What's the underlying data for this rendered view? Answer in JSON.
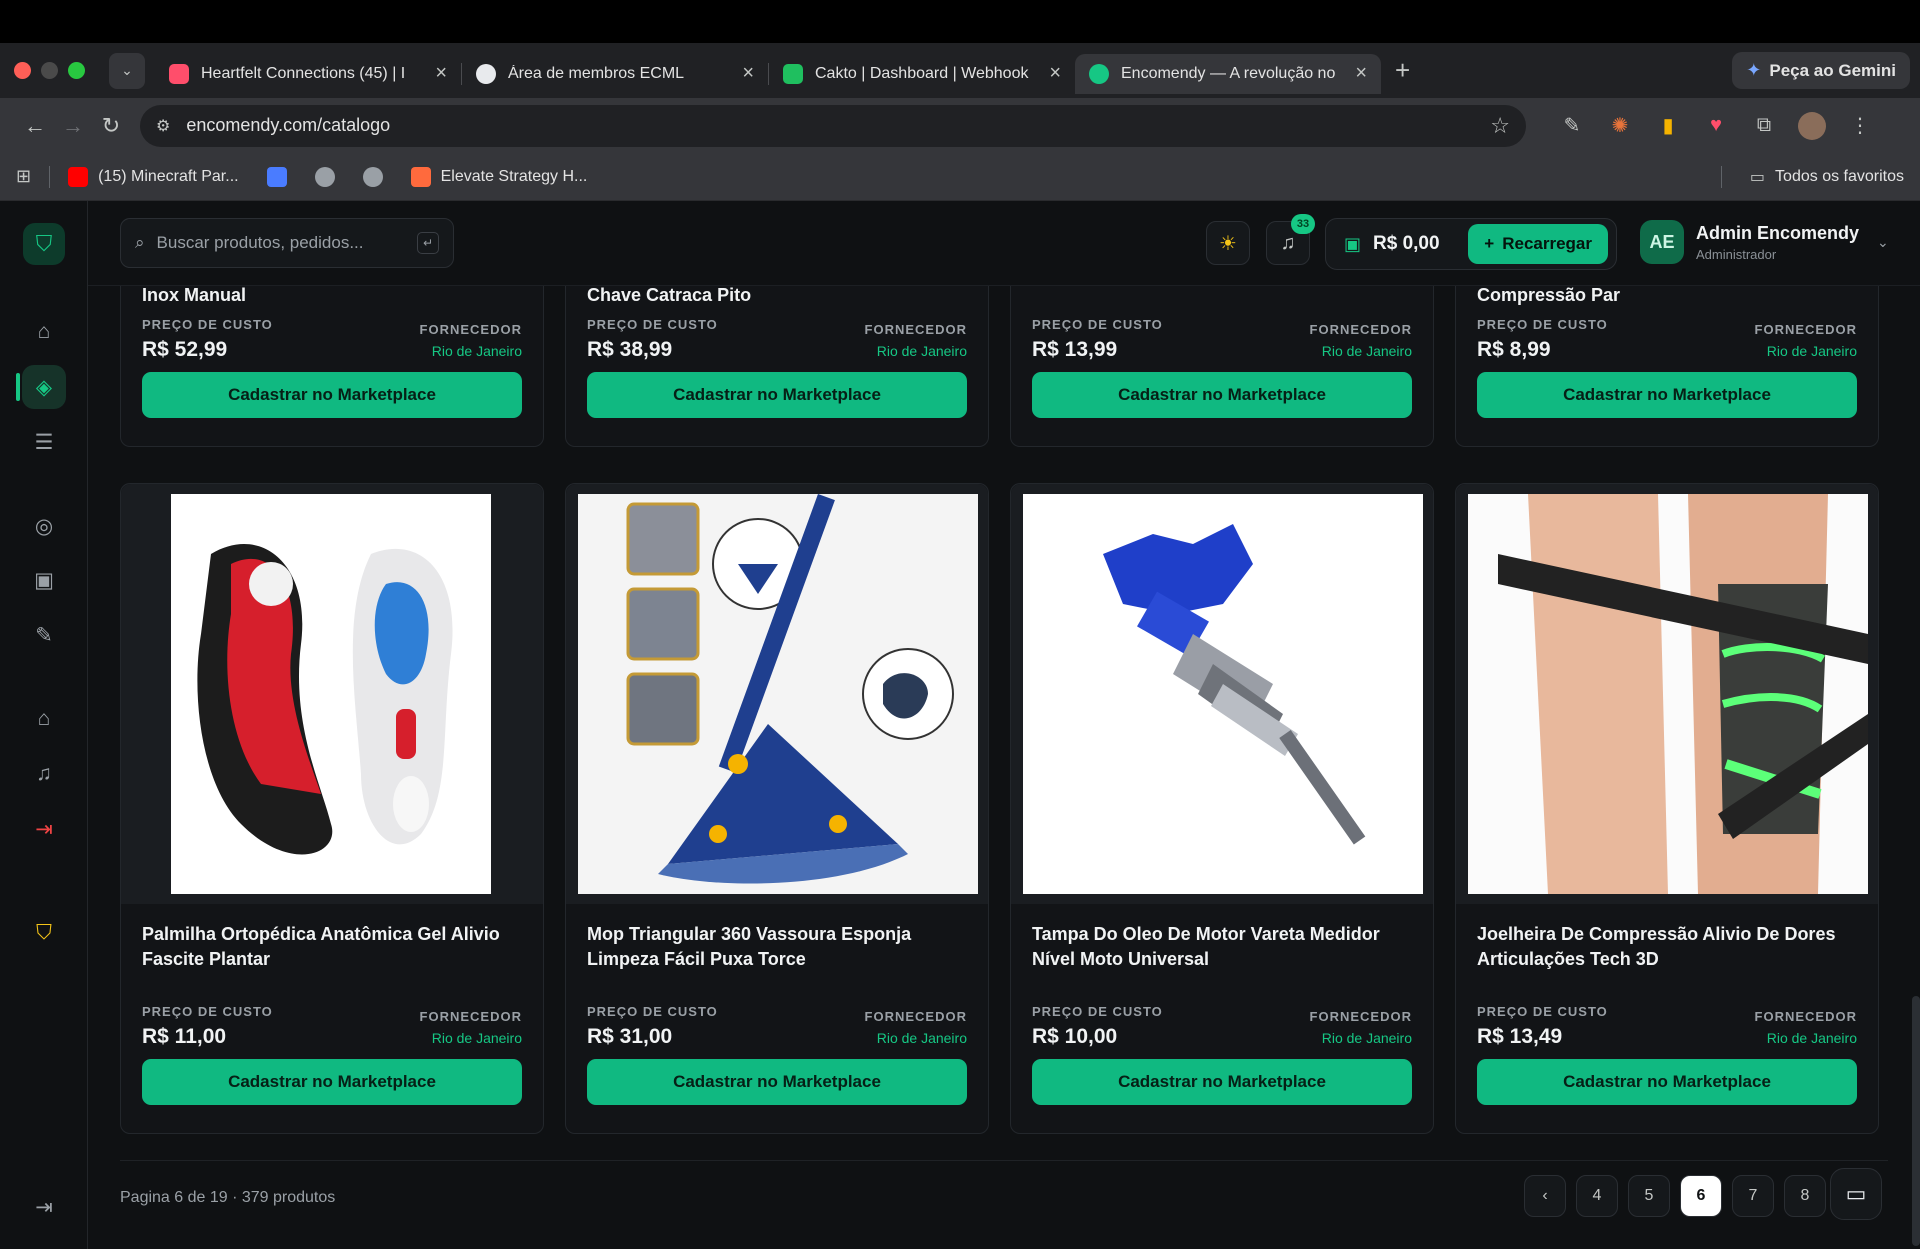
{
  "browser": {
    "tabs": [
      {
        "title": "Heartfelt Connections (45) | I",
        "favicon_color": "#ff4e6b"
      },
      {
        "title": "Área de membros ECML",
        "favicon_color": "#e8eaed"
      },
      {
        "title": "Cakto | Dashboard | Webhook",
        "favicon_color": "#1fbf5f"
      },
      {
        "title": "Encomendy — A revolução no",
        "favicon_color": "#16c784"
      }
    ],
    "gemini_label": "Peça ao Gemini",
    "url": "encomendy.com/catalogo",
    "bookmarks": [
      {
        "label": "(15) Minecraft Par...",
        "color": "#ff0000"
      },
      {
        "label": "",
        "color": "#4a7cff"
      },
      {
        "label": "",
        "color": "#9aa0a6"
      },
      {
        "label": "",
        "color": "#9aa0a6"
      },
      {
        "label": "Elevate Strategy H...",
        "color": "#ff6a3d"
      }
    ],
    "favorites_label": "Todos os favoritos"
  },
  "topbar": {
    "search_placeholder": "Buscar produtos, pedidos...",
    "search_shortcut": "↵",
    "notifications_count": "33",
    "balance": "R$ 0,00",
    "recharge_label": "Recarregar",
    "user_initials": "AE",
    "user_name": "Admin Encomendy",
    "user_role": "Administrador"
  },
  "labels": {
    "cost_price": "PREÇO DE CUSTO",
    "supplier": "FORNECEDOR",
    "cta": "Cadastrar no Marketplace"
  },
  "top_products": [
    {
      "name": "Inox Manual",
      "price": "R$ 52,99",
      "supplier": "Rio de Janeiro"
    },
    {
      "name": "Chave Catraca Pito",
      "price": "R$ 38,99",
      "supplier": "Rio de Janeiro"
    },
    {
      "name": "",
      "price": "R$ 13,99",
      "supplier": "Rio de Janeiro"
    },
    {
      "name": "Compressão Par",
      "price": "R$ 8,99",
      "supplier": "Rio de Janeiro"
    }
  ],
  "products": [
    {
      "name": "Palmilha Ortopédica Anatômica Gel Alivio Fascite Plantar",
      "price": "R$ 11,00",
      "supplier": "Rio de Janeiro"
    },
    {
      "name": "Mop Triangular 360 Vassoura Esponja Limpeza Fácil Puxa Torce",
      "price": "R$ 31,00",
      "supplier": "Rio de Janeiro"
    },
    {
      "name": "Tampa Do Oleo De Motor Vareta Medidor Nível Moto Universal",
      "price": "R$ 10,00",
      "supplier": "Rio de Janeiro"
    },
    {
      "name": "Joelheira De Compressão Alivio De Dores Articulações Tech 3D",
      "price": "R$ 13,49",
      "supplier": "Rio de Janeiro"
    }
  ],
  "pagination": {
    "info": "Pagina 6 de 19 · 379 produtos",
    "pages": [
      "4",
      "5",
      "6",
      "7",
      "8"
    ],
    "current": "6"
  },
  "colors": {
    "accent": "#10b981",
    "background": "#0f1113",
    "card": "#121417"
  }
}
